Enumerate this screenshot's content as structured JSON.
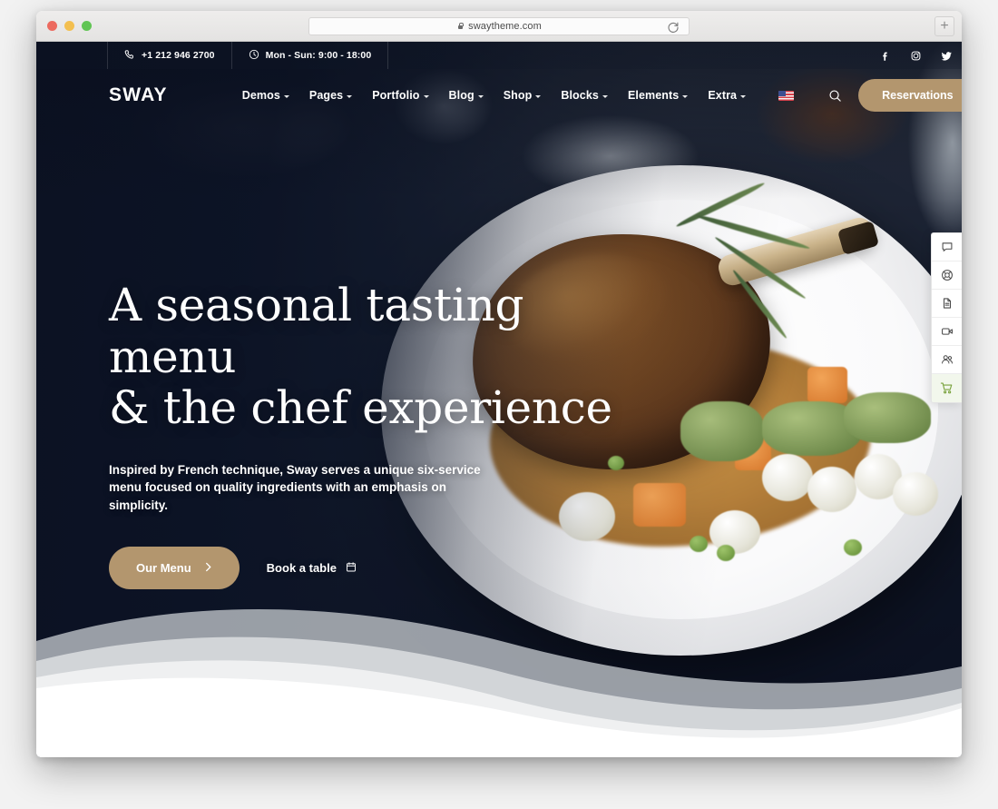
{
  "browser": {
    "url": "swaytheme.com",
    "lock_icon": "lock-icon",
    "reload_icon": "reload-icon",
    "new_tab_label": "+",
    "traffic_lights": [
      "close-red",
      "minimize-yellow",
      "zoom-green"
    ]
  },
  "topbar": {
    "phone": "+1 212 946 2700",
    "phone_icon": "phone-icon",
    "hours": "Mon - Sun: 9:00 - 18:00",
    "hours_icon": "clock-icon",
    "social": [
      {
        "name": "facebook-icon",
        "glyph": "f"
      },
      {
        "name": "instagram-icon",
        "glyph": "◎"
      },
      {
        "name": "twitter-icon",
        "glyph": "t"
      }
    ]
  },
  "nav": {
    "logo": "SWAY",
    "items": [
      {
        "label": "Demos",
        "has_dropdown": true
      },
      {
        "label": "Pages",
        "has_dropdown": true
      },
      {
        "label": "Portfolio",
        "has_dropdown": true
      },
      {
        "label": "Blog",
        "has_dropdown": true
      },
      {
        "label": "Shop",
        "has_dropdown": true
      },
      {
        "label": "Blocks",
        "has_dropdown": true
      },
      {
        "label": "Elements",
        "has_dropdown": true
      },
      {
        "label": "Extra",
        "has_dropdown": true
      }
    ],
    "language_flag": "us-flag-icon",
    "search_icon": "search-icon",
    "reservations_label": "Reservations",
    "accent_color": "#b3966e"
  },
  "hero": {
    "title_line1": "A seasonal tasting menu",
    "title_line2": "& the chef experience",
    "subtitle": "Inspired by French technique, Sway serves a unique six-service menu focused on quality ingredients with an emphasis on simplicity.",
    "primary_button": "Our Menu",
    "primary_button_icon": "chevron-right-icon",
    "secondary_button": "Book a table",
    "secondary_button_icon": "calendar-icon",
    "background_color": "#0d1527"
  },
  "side_dock": {
    "items": [
      {
        "name": "chat-icon",
        "active": false
      },
      {
        "name": "support-icon",
        "active": false
      },
      {
        "name": "document-icon",
        "active": false
      },
      {
        "name": "video-icon",
        "active": false
      },
      {
        "name": "users-icon",
        "active": false
      },
      {
        "name": "cart-icon",
        "active": true
      }
    ],
    "active_color": "#7aa33e"
  }
}
